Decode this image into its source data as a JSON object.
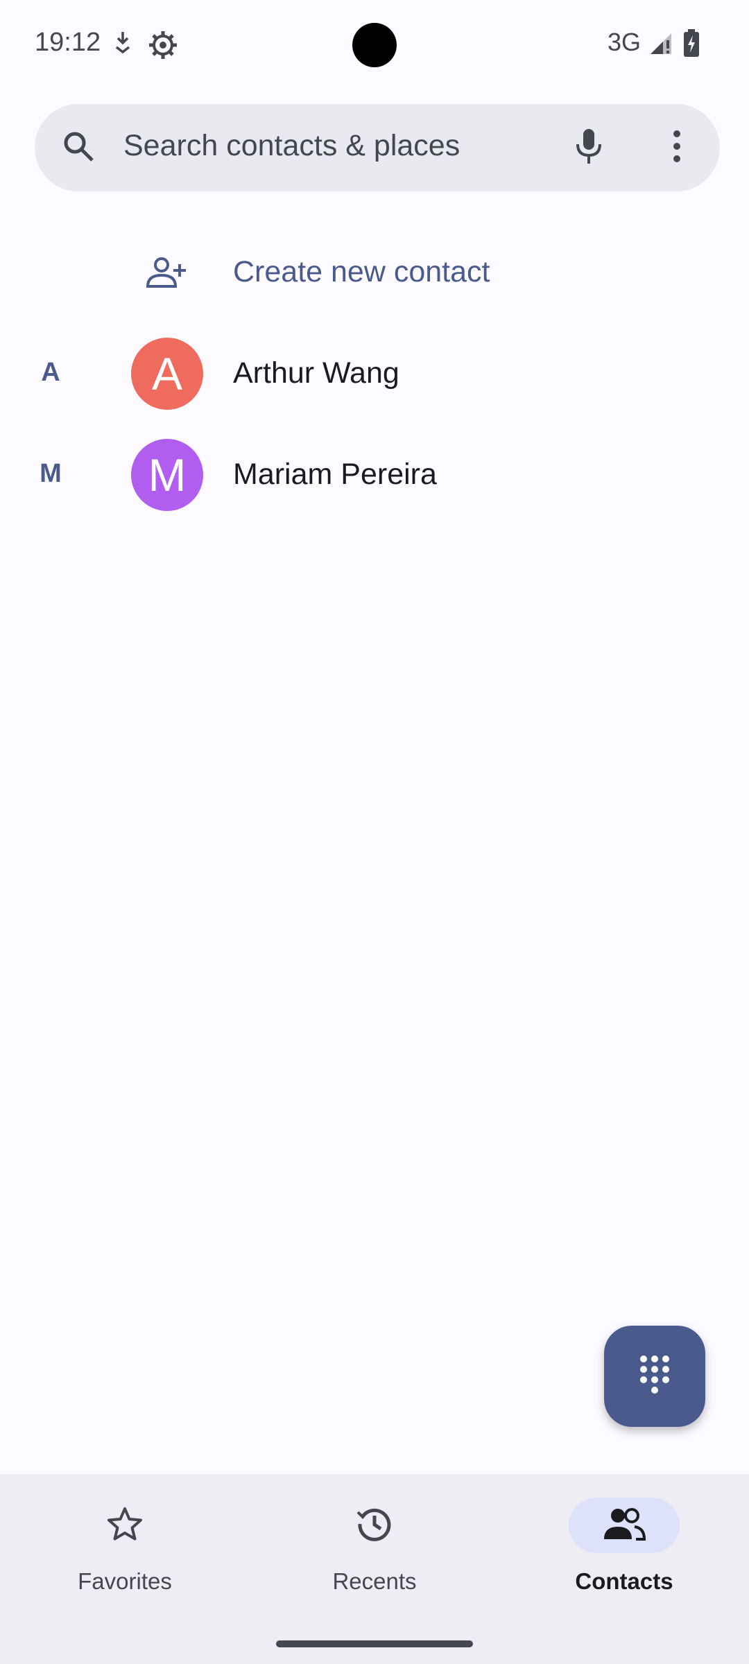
{
  "status_bar": {
    "time": "19:12",
    "network": "3G",
    "icons": [
      "download-icon",
      "settings-gear-icon",
      "signal-icon",
      "battery-charging-icon"
    ]
  },
  "search": {
    "placeholder": "Search contacts & places",
    "icons": [
      "search-icon",
      "mic-icon",
      "more-vert-icon"
    ]
  },
  "list": {
    "create_new": "Create new contact",
    "contacts": [
      {
        "section": "A",
        "initial": "A",
        "name": "Arthur Wang",
        "color": "#EE6B5D"
      },
      {
        "section": "M",
        "initial": "M",
        "name": "Mariam Pereira",
        "color": "#B15DF0"
      }
    ]
  },
  "fab": {
    "icon": "dialpad-icon"
  },
  "bottom_nav": {
    "items": [
      {
        "label": "Favorites",
        "icon": "star-outline-icon",
        "active": false
      },
      {
        "label": "Recents",
        "icon": "clock-history-icon",
        "active": false
      },
      {
        "label": "Contacts",
        "icon": "contacts-icon",
        "active": true
      }
    ]
  },
  "colors": {
    "accent": "#4A5A8C",
    "background": "#FDFBFF",
    "nav_background": "#EFEDF4",
    "active_pill": "#DDE1F9"
  }
}
